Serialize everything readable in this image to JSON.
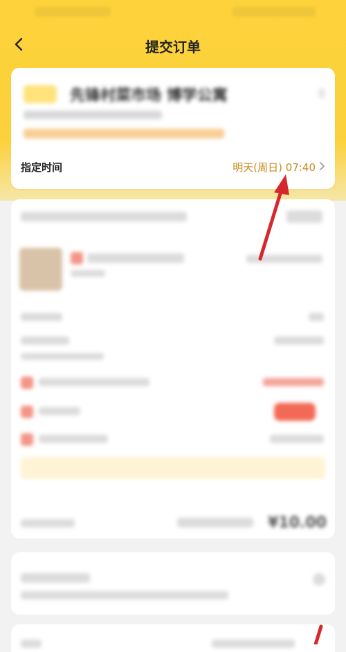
{
  "header": {
    "title": "提交订单",
    "back_icon": "chevron-left-icon"
  },
  "store": {
    "name": "先锋村菜市场 博学公寓"
  },
  "delivery": {
    "label": "指定时间",
    "value": "明天(周日) 07:40",
    "chevron_icon": "chevron-right-icon"
  },
  "order": {
    "total": "¥10.00"
  },
  "colors": {
    "brand_yellow": "#fdd23a",
    "time_text": "#c78a1e",
    "arrow_red": "#d6282c"
  }
}
